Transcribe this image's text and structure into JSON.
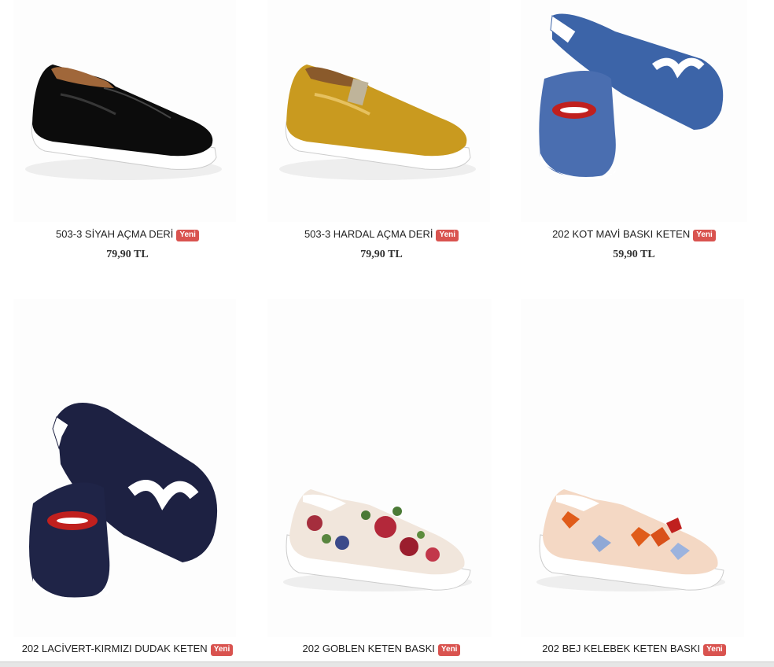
{
  "products": [
    {
      "name": "503-3 SİYAH AÇMA DERİ",
      "badge": "Yeni",
      "price": "79,90 TL",
      "image": "black-patent-slip-on-shoe"
    },
    {
      "name": "503-3 HARDAL AÇMA DERİ",
      "badge": "Yeni",
      "price": "79,90 TL",
      "image": "mustard-patent-slip-on-shoe"
    },
    {
      "name": "202 KOT MAVİ BASKI KETEN",
      "badge": "Yeni",
      "price": "59,90 TL",
      "image": "denim-lips-mustache-shoes"
    },
    {
      "name": "202 LACİVERT-KIRMIZI DUDAK KETEN",
      "badge": "Yeni",
      "image": "navy-lips-mustache-shoes"
    },
    {
      "name": "202 GOBLEN KETEN BASKI",
      "badge": "Yeni",
      "image": "floral-tapestry-slip-on"
    },
    {
      "name": "202 BEJ KELEBEK KETEN BASKI",
      "badge": "Yeni",
      "image": "beige-butterfly-slip-on"
    }
  ],
  "colors": {
    "badge": "#d9534f",
    "text": "#222222"
  }
}
